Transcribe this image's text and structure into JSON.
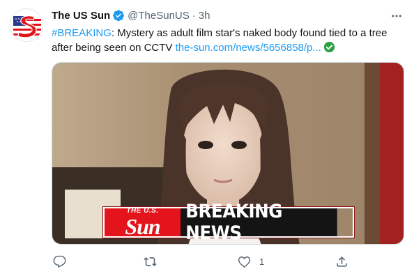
{
  "tweet": {
    "author": {
      "display_name": "The US Sun",
      "handle": "@TheSunUS",
      "verified": true,
      "avatar_icon": "the-us-sun-logo-icon"
    },
    "separator": "·",
    "time": "3h",
    "text": {
      "hashtag": "#BREAKING",
      "body": ": Mystery as adult film star's naked body found tied to a tree after being seen on CCTV ",
      "link": "the-sun.com/news/5656858/p...",
      "trailing_emoji": "check-mark-button-emoji"
    },
    "media": {
      "banner_logo_small": "THE U.S.",
      "banner_logo_big": "Sun",
      "banner_text": "BREAKING NEWS"
    },
    "actions": {
      "reply_count": "",
      "retweet_count": "",
      "like_count": "1",
      "share_count": ""
    }
  },
  "colors": {
    "link_blue": "#1d9bf0",
    "verified_blue": "#1d9bf0",
    "sun_red": "#e3141b",
    "secondary_text": "#536471",
    "emoji_green": "#2ea043"
  }
}
